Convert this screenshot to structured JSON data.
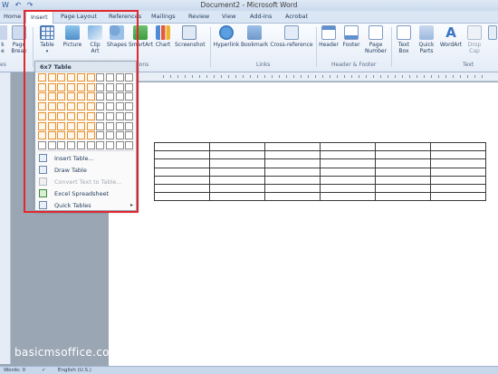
{
  "window": {
    "title": "Document2 - Microsoft Word"
  },
  "tabs": [
    "Home",
    "Insert",
    "Page Layout",
    "References",
    "Mailings",
    "Review",
    "View",
    "Add-Ins",
    "Acrobat"
  ],
  "active_tab": "Insert",
  "ribbon": {
    "left_partial": {
      "btn1": "k\ne",
      "btn2": "Page\nBreak",
      "group": "es"
    },
    "table_btn": "Table",
    "picture_btn": "Picture",
    "clipart_btn": "Clip\nArt",
    "shapes_btn": "Shapes",
    "smartart_btn": "SmartArt",
    "chart_btn": "Chart",
    "screenshot_btn": "Screenshot",
    "illustrations_group_partial": "ions",
    "hyperlink_btn": "Hyperlink",
    "bookmark_btn": "Bookmark",
    "crossref_btn": "Cross-reference",
    "links_group": "Links",
    "header_btn": "Header",
    "footer_btn": "Footer",
    "pagenumber_btn": "Page\nNumber",
    "hf_group": "Header & Footer",
    "textbox_btn": "Text\nBox",
    "quickparts_btn": "Quick\nParts",
    "wordart_btn": "WordArt",
    "dropcap_btn": "Drop\nCap",
    "text_group": "Text"
  },
  "dropdown": {
    "header": "6x7 Table",
    "grid_cols": 10,
    "grid_rows": 8,
    "selected_cols": 6,
    "selected_rows": 7,
    "items": [
      {
        "label": "Insert Table...",
        "enabled": true,
        "submenu": false
      },
      {
        "label": "Draw Table",
        "enabled": true,
        "submenu": false
      },
      {
        "label": "Convert Text to Table...",
        "enabled": false,
        "submenu": false
      },
      {
        "label": "Excel Spreadsheet",
        "enabled": true,
        "submenu": false
      },
      {
        "label": "Quick Tables",
        "enabled": true,
        "submenu": true
      }
    ]
  },
  "document_table": {
    "rows": 7,
    "cols": 6
  },
  "status": {
    "words": "Words: 0",
    "language": "English (U.S.)"
  },
  "watermark": "basicmsoffice.com"
}
